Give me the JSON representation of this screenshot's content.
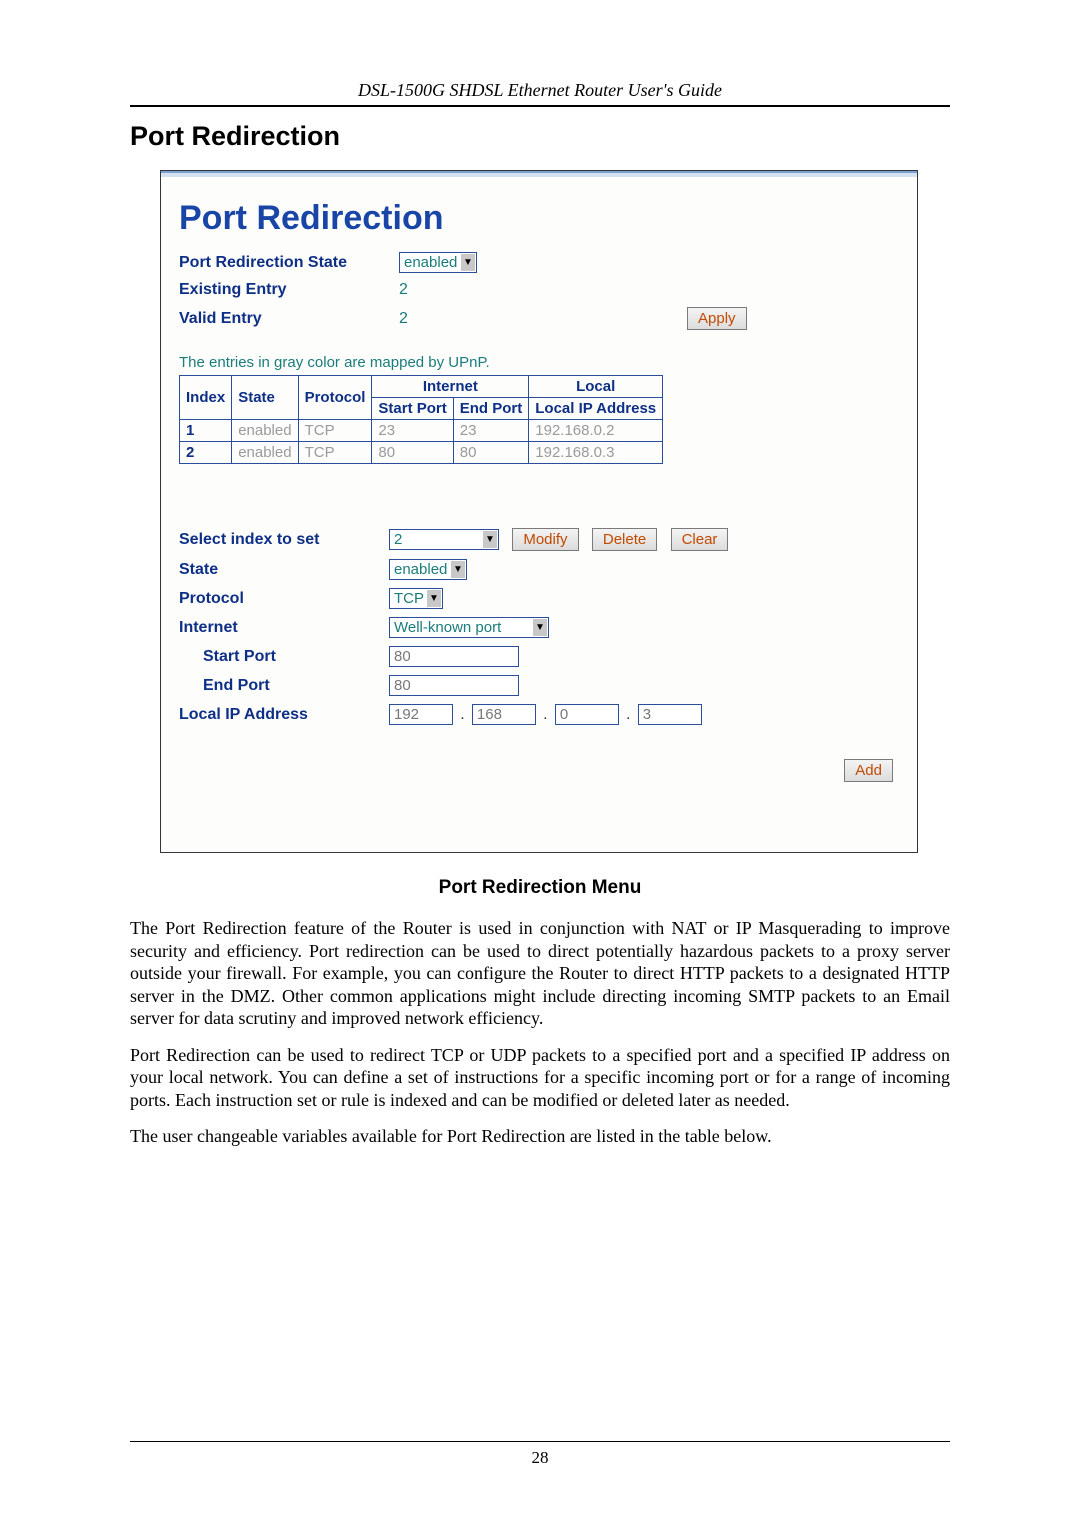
{
  "doc": {
    "running_header": "DSL-1500G SHDSL Ethernet Router User's Guide",
    "section_title": "Port Redirection",
    "fig_caption": "Port Redirection Menu",
    "paras": [
      "The Port Redirection feature of the Router is used in conjunction with NAT or IP Masquerading to improve security and efficiency. Port redirection can be used to direct potentially hazardous packets to a proxy server outside your firewall. For example, you can configure the Router to direct HTTP packets to a designated HTTP server in the DMZ. Other common applications might include directing incoming SMTP packets to an Email server for data scrutiny and improved network efficiency.",
      "Port Redirection can be used to redirect TCP or UDP packets to a specified port and a specified IP address on your local network. You can define a set of instructions for a specific incoming port or for a range of incoming ports. Each instruction set or rule is indexed and can be modified or deleted later as needed.",
      "The user changeable variables available for Port Redirection are listed in the table below."
    ],
    "page_number": "28"
  },
  "app": {
    "title": "Port Redirection",
    "state_label": "Port Redirection State",
    "state_value": "enabled",
    "existing_label": "Existing Entry",
    "existing_value": "2",
    "valid_label": "Valid Entry",
    "valid_value": "2",
    "apply_btn": "Apply",
    "upnp_note": "The entries in gray color are mapped by UPnP.",
    "table": {
      "group_internet": "Internet",
      "group_local": "Local",
      "cols": [
        "Index",
        "State",
        "Protocol",
        "Start Port",
        "End Port",
        "Local IP Address"
      ],
      "rows": [
        {
          "index": "1",
          "state": "enabled",
          "proto": "TCP",
          "start": "23",
          "end": "23",
          "ip": "192.168.0.2"
        },
        {
          "index": "2",
          "state": "enabled",
          "proto": "TCP",
          "start": "80",
          "end": "80",
          "ip": "192.168.0.3"
        }
      ]
    },
    "select_index_label": "Select index to set",
    "select_index_value": "2",
    "modify_btn": "Modify",
    "delete_btn": "Delete",
    "clear_btn": "Clear",
    "state2_label": "State",
    "state2_value": "enabled",
    "proto_label": "Protocol",
    "proto_value": "TCP",
    "internet_label": "Internet",
    "internet_value": "Well-known port",
    "startport_label": "Start Port",
    "startport_value": "80",
    "endport_label": "End Port",
    "endport_value": "80",
    "localip_label": "Local IP Address",
    "localip": {
      "a": "192",
      "b": "168",
      "c": "0",
      "d": "3"
    },
    "add_btn": "Add"
  }
}
